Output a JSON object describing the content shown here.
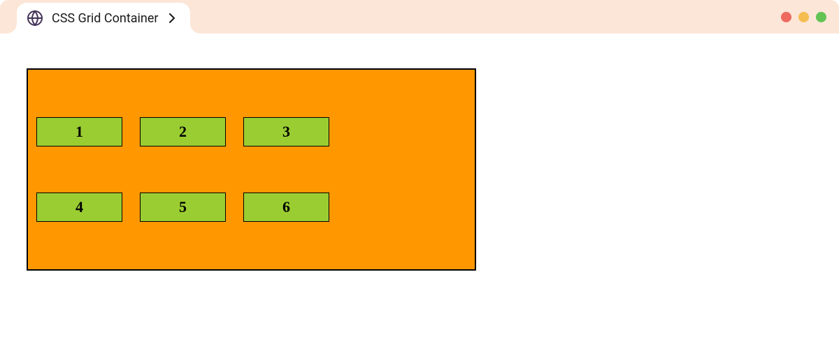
{
  "tab": {
    "title": "CSS Grid Container"
  },
  "grid": {
    "items": [
      "1",
      "2",
      "3",
      "4",
      "5",
      "6"
    ]
  }
}
